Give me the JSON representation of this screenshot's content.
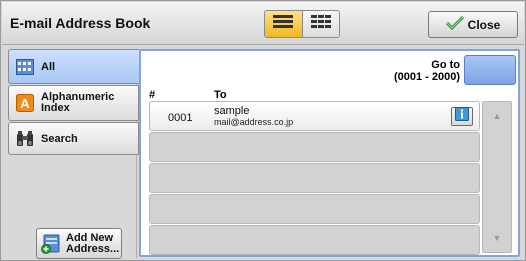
{
  "header": {
    "title": "E-mail Address Book",
    "view_toggle": [
      "list-view",
      "grid-view"
    ],
    "close_label": "Close"
  },
  "nav": {
    "items": [
      {
        "label": "All",
        "icon": "address-book-grid-icon",
        "selected": true
      },
      {
        "label_line1": "Alphanumeric",
        "label_line2": "Index",
        "icon": "letter-a-icon",
        "selected": false
      },
      {
        "label": "Search",
        "icon": "binoculars-icon",
        "selected": false
      }
    ],
    "add_line1": "Add New",
    "add_line2": "Address..."
  },
  "list": {
    "col_number": "#",
    "col_to": "To",
    "goto_line1": "Go to",
    "goto_line2": "(0001 - 2000)",
    "goto_value": "",
    "rows": [
      {
        "number": "0001",
        "name": "sample",
        "email": "mail@address.co.jp"
      }
    ]
  },
  "colors": {
    "accent_blue": "#7fa6dd",
    "selected_yellow": "#f0b820"
  }
}
